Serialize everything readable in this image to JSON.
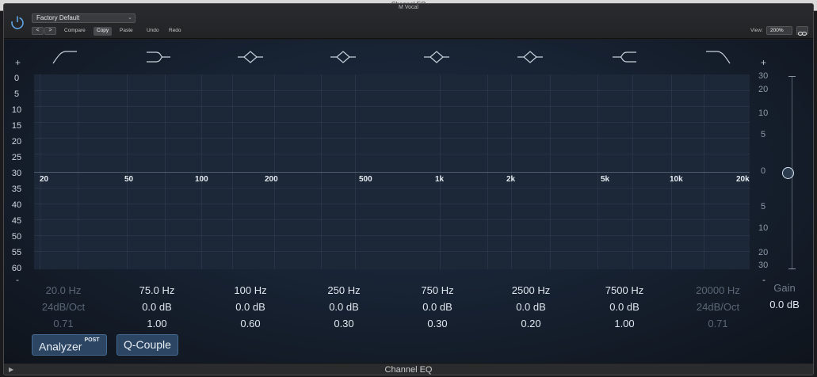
{
  "window": {
    "title": "M Vocal",
    "footer_title": "Channel EQ"
  },
  "header": {
    "preset": "Factory Default",
    "nav_prev": "<",
    "nav_next": ">",
    "compare": "Compare",
    "copy": "Copy",
    "paste": "Paste",
    "undo": "Undo",
    "redo": "Redo",
    "view_label": "View:",
    "view_value": "200%"
  },
  "graph": {
    "db_scale_left": [
      "0",
      "5",
      "10",
      "15",
      "20",
      "25",
      "30",
      "35",
      "40",
      "45",
      "50",
      "55",
      "60"
    ],
    "db_scale_right_top": [
      "30",
      "20",
      "10",
      "5"
    ],
    "db_scale_right_zero": "0",
    "db_scale_right_bottom": [
      "5",
      "10",
      "20",
      "30"
    ],
    "plus": "+",
    "minus": "-",
    "freq_labels": [
      "20",
      "50",
      "100",
      "200",
      "500",
      "1k",
      "2k",
      "5k",
      "10k",
      "20k"
    ]
  },
  "bands": [
    {
      "freq": "20.0 Hz",
      "gain": "24dB/Oct",
      "q": "0.71",
      "enabled": false,
      "icon": "low-cut-icon"
    },
    {
      "freq": "75.0 Hz",
      "gain": "0.0 dB",
      "q": "1.00",
      "enabled": true,
      "icon": "low-shelf-icon"
    },
    {
      "freq": "100 Hz",
      "gain": "0.0 dB",
      "q": "0.60",
      "enabled": true,
      "icon": "bell-icon"
    },
    {
      "freq": "250 Hz",
      "gain": "0.0 dB",
      "q": "0.30",
      "enabled": true,
      "icon": "bell-icon"
    },
    {
      "freq": "750 Hz",
      "gain": "0.0 dB",
      "q": "0.30",
      "enabled": true,
      "icon": "bell-icon"
    },
    {
      "freq": "2500 Hz",
      "gain": "0.0 dB",
      "q": "0.20",
      "enabled": true,
      "icon": "bell-icon"
    },
    {
      "freq": "7500 Hz",
      "gain": "0.0 dB",
      "q": "1.00",
      "enabled": true,
      "icon": "high-shelf-icon"
    },
    {
      "freq": "20000 Hz",
      "gain": "24dB/Oct",
      "q": "0.71",
      "enabled": false,
      "icon": "high-cut-icon"
    }
  ],
  "master_gain": {
    "label": "Gain",
    "value": "0.0 dB"
  },
  "buttons": {
    "analyzer": "Analyzer",
    "analyzer_badge": "POST",
    "q_couple": "Q-Couple"
  },
  "colors": {
    "accent": "#2b4562",
    "grid_bg": "#1c2738"
  }
}
